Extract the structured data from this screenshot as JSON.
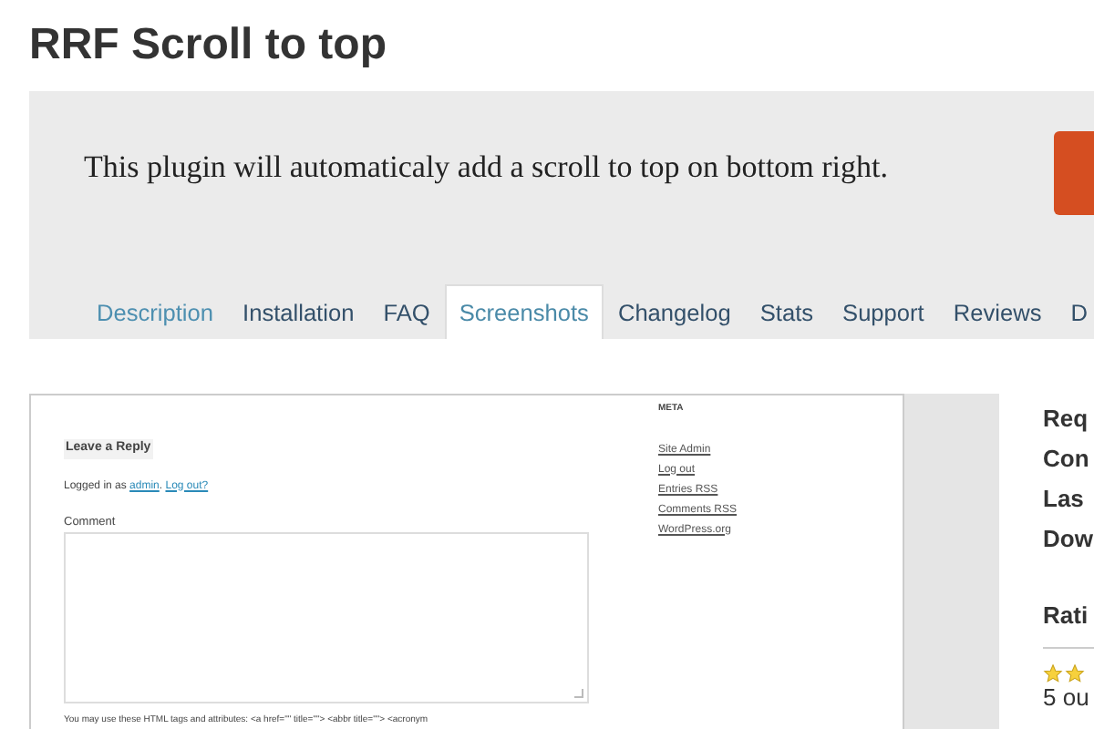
{
  "title": "RRF Scroll to top",
  "banner": {
    "text": "This plugin will automaticaly add a scroll to top on bottom right."
  },
  "tabs": [
    {
      "label": "Description",
      "selected": false,
      "kind": "link"
    },
    {
      "label": "Installation",
      "selected": false,
      "kind": "tab"
    },
    {
      "label": "FAQ",
      "selected": false,
      "kind": "tab"
    },
    {
      "label": "Screenshots",
      "selected": true,
      "kind": "tab"
    },
    {
      "label": "Changelog",
      "selected": false,
      "kind": "tab"
    },
    {
      "label": "Stats",
      "selected": false,
      "kind": "tab"
    },
    {
      "label": "Support",
      "selected": false,
      "kind": "tab"
    },
    {
      "label": "Reviews",
      "selected": false,
      "kind": "tab"
    },
    {
      "label": "D",
      "selected": false,
      "kind": "tab"
    }
  ],
  "screenshot": {
    "heading": "Leave a Reply",
    "logged_in": "Logged in as",
    "user_link": "admin",
    "separator": ".",
    "logout_link": "Log out?",
    "comment_label": "Comment",
    "hint": "You may use these HTML tags and attributes: <a href=\"\" title=\"\"> <abbr title=\"\"> <acronym",
    "meta_title": "META",
    "meta_links": [
      "Site Admin",
      "Log out",
      "Entries RSS",
      "Comments RSS",
      "WordPress.org"
    ]
  },
  "info": [
    "Req",
    "Con",
    "Las",
    "Dow"
  ],
  "ratings": {
    "title": "Rati",
    "summary": "5 ou"
  }
}
